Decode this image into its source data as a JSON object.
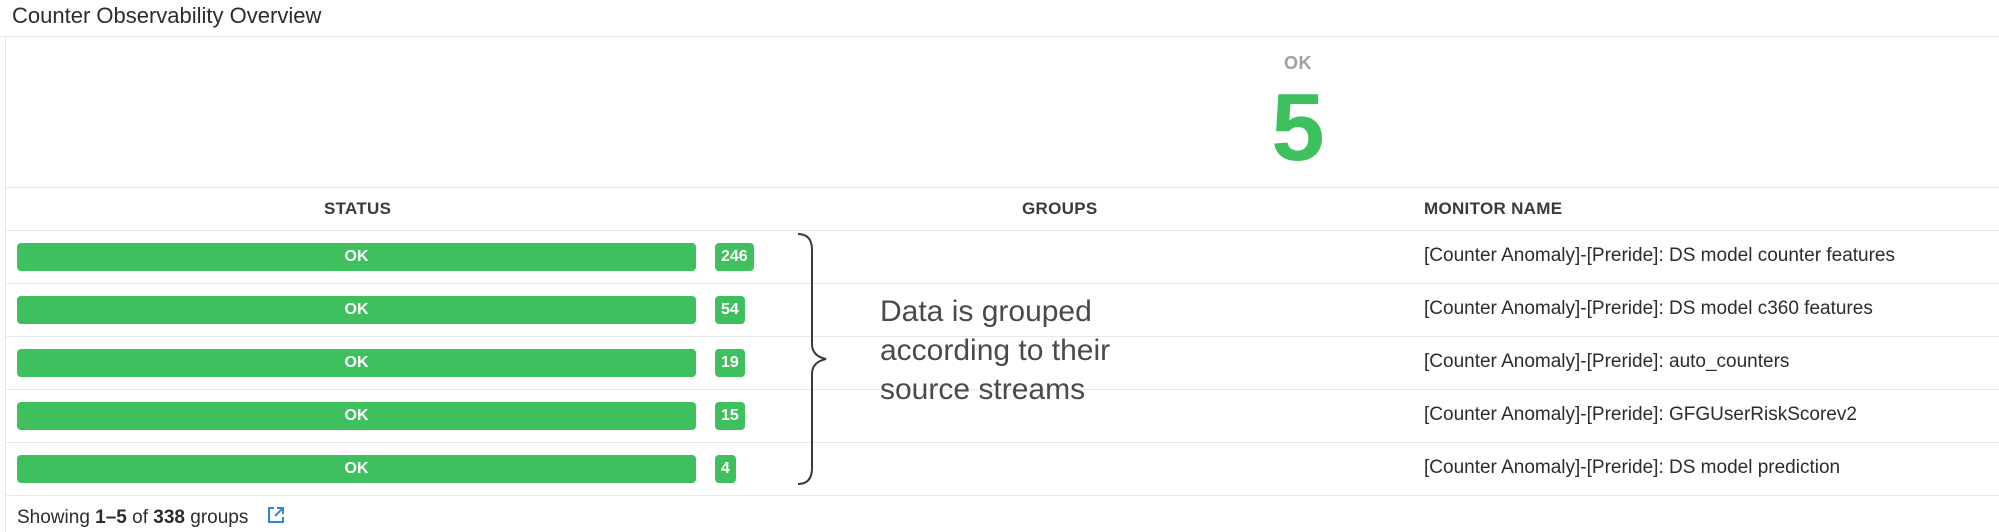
{
  "widget": {
    "title": "Counter Observability Overview"
  },
  "summary": {
    "label": "OK",
    "count": "5",
    "color": "#3ec05f"
  },
  "table": {
    "headers": {
      "status": "STATUS",
      "groups": "GROUPS",
      "monitor": "MONITOR NAME"
    },
    "rows": [
      {
        "status": "OK",
        "count": "246",
        "monitor": "[Counter Anomaly]-[Preride]: DS model counter features"
      },
      {
        "status": "OK",
        "count": "54",
        "monitor": "[Counter Anomaly]-[Preride]: DS model c360 features"
      },
      {
        "status": "OK",
        "count": "19",
        "monitor": "[Counter Anomaly]-[Preride]: auto_counters"
      },
      {
        "status": "OK",
        "count": "15",
        "monitor": "[Counter Anomaly]-[Preride]: GFGUserRiskScorev2"
      },
      {
        "status": "OK",
        "count": "4",
        "monitor": "[Counter Anomaly]-[Preride]: DS model prediction"
      }
    ]
  },
  "annotation": {
    "line1": "Data is grouped",
    "line2": "according to their",
    "line3": "source streams"
  },
  "footer": {
    "prefix": "Showing ",
    "range": "1–5",
    "middle": " of ",
    "total": "338",
    "suffix": " groups",
    "link_icon": "external-link-icon"
  },
  "colors": {
    "ok_green": "#3ec05f",
    "link_blue": "#2f86d6"
  }
}
